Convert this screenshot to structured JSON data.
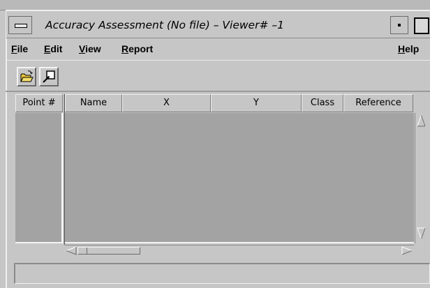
{
  "window": {
    "title": "Accuracy Assessment (No file) – Viewer# –1"
  },
  "menubar": {
    "items": [
      {
        "label_ul": "F",
        "label_rest": "ile"
      },
      {
        "label_ul": "E",
        "label_rest": "dit"
      },
      {
        "label_ul": "V",
        "label_rest": "iew"
      },
      {
        "label_ul": "R",
        "label_rest": "eport"
      }
    ],
    "help": {
      "label_ul": "H",
      "label_rest": "elp"
    }
  },
  "toolbar": {
    "open_icon": "open-folder-icon",
    "select_icon": "select-point-tool-icon"
  },
  "table": {
    "row_header": "Point #",
    "columns": [
      "Name",
      "X",
      "Y",
      "Class",
      "Reference"
    ],
    "rows": []
  },
  "status": {
    "text": ""
  },
  "colors": {
    "background": "#c6c6c6",
    "grid": "#a3a3a3"
  }
}
